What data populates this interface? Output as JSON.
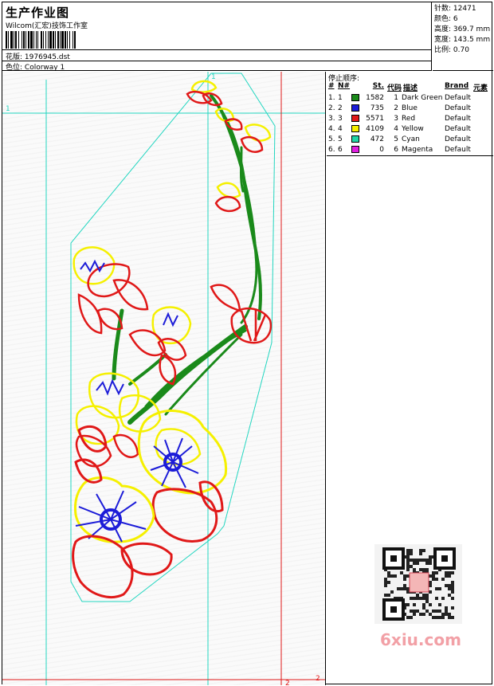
{
  "header": {
    "title": "生产作业图",
    "studio": "Wilcom(汇宏)技饰工作室",
    "design_label": "花版:",
    "design_file": "1976945.dst",
    "colorway_label": "色位:",
    "colorway": "Colorway 1"
  },
  "stats": [
    {
      "label": "针数:",
      "value": "12471"
    },
    {
      "label": "颜色:",
      "value": "6"
    },
    {
      "label": "高度:",
      "value": "369.7 mm"
    },
    {
      "label": "宽度:",
      "value": "143.5 mm"
    },
    {
      "label": "比例:",
      "value": "0.70"
    }
  ],
  "color_table": {
    "title": "停止顺序:",
    "headers": {
      "num": "#",
      "n2": "N#",
      "st": "St.",
      "code": "代码",
      "desc": "描述",
      "brand": "Brand",
      "elem": "元素"
    },
    "rows": [
      {
        "num": "1.",
        "n2": "1",
        "color": "#1a8a1a",
        "st": "1582",
        "code": "1",
        "desc": "Dark Green",
        "brand": "Default"
      },
      {
        "num": "2.",
        "n2": "2",
        "color": "#1c1cd8",
        "st": "735",
        "code": "2",
        "desc": "Blue",
        "brand": "Default"
      },
      {
        "num": "3.",
        "n2": "3",
        "color": "#e01818",
        "st": "5571",
        "code": "3",
        "desc": "Red",
        "brand": "Default"
      },
      {
        "num": "4.",
        "n2": "4",
        "color": "#f5f000",
        "st": "4109",
        "code": "4",
        "desc": "Yellow",
        "brand": "Default"
      },
      {
        "num": "5.",
        "n2": "5",
        "color": "#22d6a6",
        "st": "472",
        "code": "5",
        "desc": "Cyan",
        "brand": "Default"
      },
      {
        "num": "6.",
        "n2": "6",
        "color": "#e020e0",
        "st": "0",
        "code": "6",
        "desc": "Magenta",
        "brand": "Default"
      }
    ]
  },
  "guides": {
    "marker1": "1",
    "marker2": "2"
  },
  "watermark": {
    "text": "6xiu.com"
  },
  "colors": {
    "guide_cyan": "#22d6c0",
    "guide_red": "#e01818",
    "stem": "#1a8a1a",
    "petal": "#e01818",
    "edge": "#f5f000",
    "center": "#1c1cd8"
  }
}
